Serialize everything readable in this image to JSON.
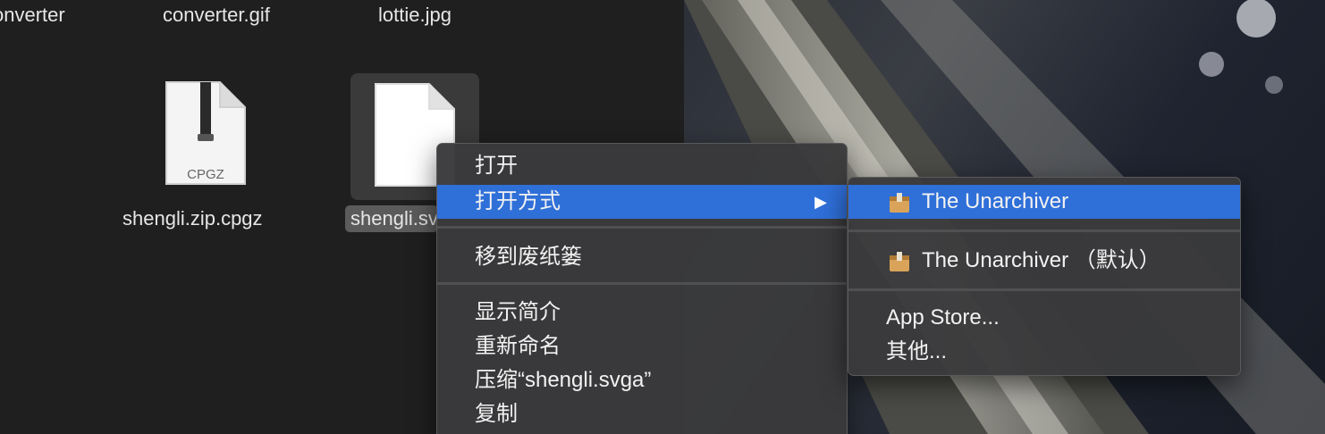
{
  "finder": {
    "top_files": [
      "onverter",
      "converter.gif",
      "lottie.jpg"
    ],
    "zip_file": {
      "name": "shengli.zip.cpgz",
      "badge": "CPGZ"
    },
    "selected_file": {
      "name": "shengli.svga"
    }
  },
  "context_menu": {
    "items": [
      "打开",
      "打开方式",
      "移到废纸篓",
      "显示简介",
      "重新命名",
      "压缩“shengli.svga”",
      "复制"
    ],
    "submenu_arrow": "▶"
  },
  "open_with_menu": {
    "items": [
      "The Unarchiver",
      "The Unarchiver （默认）",
      "App Store...",
      "其他..."
    ]
  },
  "colors": {
    "highlight": "#2f6fd8",
    "menu_bg": "#3a3a3c"
  }
}
